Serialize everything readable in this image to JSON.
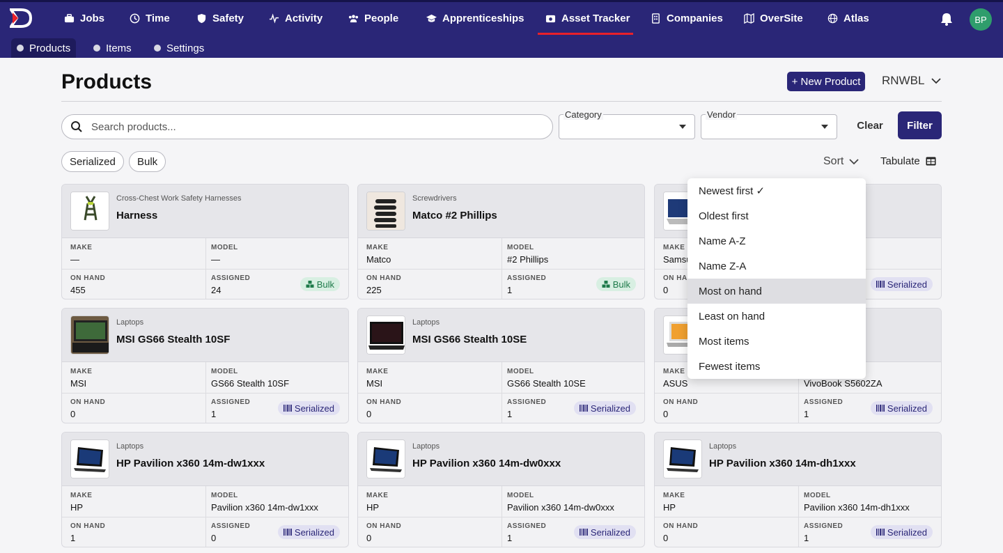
{
  "nav": {
    "items": [
      {
        "label": "Jobs",
        "icon": "briefcase-icon"
      },
      {
        "label": "Time",
        "icon": "clock-icon"
      },
      {
        "label": "Safety",
        "icon": "shield-icon"
      },
      {
        "label": "Activity",
        "icon": "pulse-icon"
      },
      {
        "label": "People",
        "icon": "people-icon"
      },
      {
        "label": "Apprenticeships",
        "icon": "graduation-cap-icon"
      },
      {
        "label": "Asset Tracker",
        "icon": "camera-box-icon"
      },
      {
        "label": "Companies",
        "icon": "building-icon"
      },
      {
        "label": "OverSite",
        "icon": "map-icon"
      },
      {
        "label": "Atlas",
        "icon": "globe-icon"
      }
    ],
    "active": "Asset Tracker",
    "avatar_initials": "BP"
  },
  "subnav": {
    "items": [
      {
        "label": "Products"
      },
      {
        "label": "Items"
      },
      {
        "label": "Settings"
      }
    ],
    "active": "Products"
  },
  "header": {
    "title": "Products",
    "new_button": "+ New Product",
    "org": "RNWBL"
  },
  "filters": {
    "search_placeholder": "Search products...",
    "category_label": "Category",
    "vendor_label": "Vendor",
    "clear_label": "Clear",
    "filter_label": "Filter",
    "chips": [
      "Serialized",
      "Bulk"
    ],
    "sort_label": "Sort",
    "tabulate_label": "Tabulate"
  },
  "labels": {
    "make": "MAKE",
    "model": "MODEL",
    "on_hand": "ON HAND",
    "assigned": "ASSIGNED"
  },
  "cards": [
    {
      "category": "Cross-Chest Work Safety Harnesses",
      "name": "Harness",
      "make": "—",
      "model": "—",
      "on_hand": "455",
      "assigned": "24",
      "badge": "Bulk"
    },
    {
      "category": "Screwdrivers",
      "name": "Matco #2 Phillips",
      "make": "Matco",
      "model": "#2 Phillips",
      "on_hand": "225",
      "assigned": "1",
      "badge": "Bulk"
    },
    {
      "category": "",
      "name": "",
      "make": "Samsu",
      "model": "",
      "on_hand": "0",
      "assigned": "",
      "badge": "Serialized"
    },
    {
      "category": "Laptops",
      "name": "MSI GS66 Stealth 10SF",
      "make": "MSI",
      "model": "GS66 Stealth 10SF",
      "on_hand": "0",
      "assigned": "1",
      "badge": "Serialized"
    },
    {
      "category": "Laptops",
      "name": "MSI GS66 Stealth 10SE",
      "make": "MSI",
      "model": "GS66 Stealth 10SE",
      "on_hand": "0",
      "assigned": "1",
      "badge": "Serialized"
    },
    {
      "category": "",
      "name": "",
      "make": "ASUS",
      "model": "VivoBook S5602ZA",
      "on_hand": "0",
      "assigned": "1",
      "badge": "Serialized"
    },
    {
      "category": "Laptops",
      "name": "HP Pavilion x360 14m-dw1xxx",
      "make": "HP",
      "model": "Pavilion x360 14m-dw1xxx",
      "on_hand": "1",
      "assigned": "0",
      "badge": "Serialized"
    },
    {
      "category": "Laptops",
      "name": "HP Pavilion x360 14m-dw0xxx",
      "make": "HP",
      "model": "Pavilion x360 14m-dw0xxx",
      "on_hand": "0",
      "assigned": "1",
      "badge": "Serialized"
    },
    {
      "category": "Laptops",
      "name": "HP Pavilion x360 14m-dh1xxx",
      "make": "HP",
      "model": "Pavilion x360 14m-dh1xxx",
      "on_hand": "0",
      "assigned": "1",
      "badge": "Serialized"
    }
  ],
  "sort_menu": {
    "items": [
      "Newest first ✓",
      "Oldest first",
      "Name A-Z",
      "Name Z-A",
      "Most on hand",
      "Least on hand",
      "Most items",
      "Fewest items"
    ],
    "highlighted": "Most on hand"
  },
  "colors": {
    "brand": "#2a2677",
    "accent": "#e8202a",
    "bulk": "#1e7a4a",
    "avatar": "#2f9d6c"
  }
}
